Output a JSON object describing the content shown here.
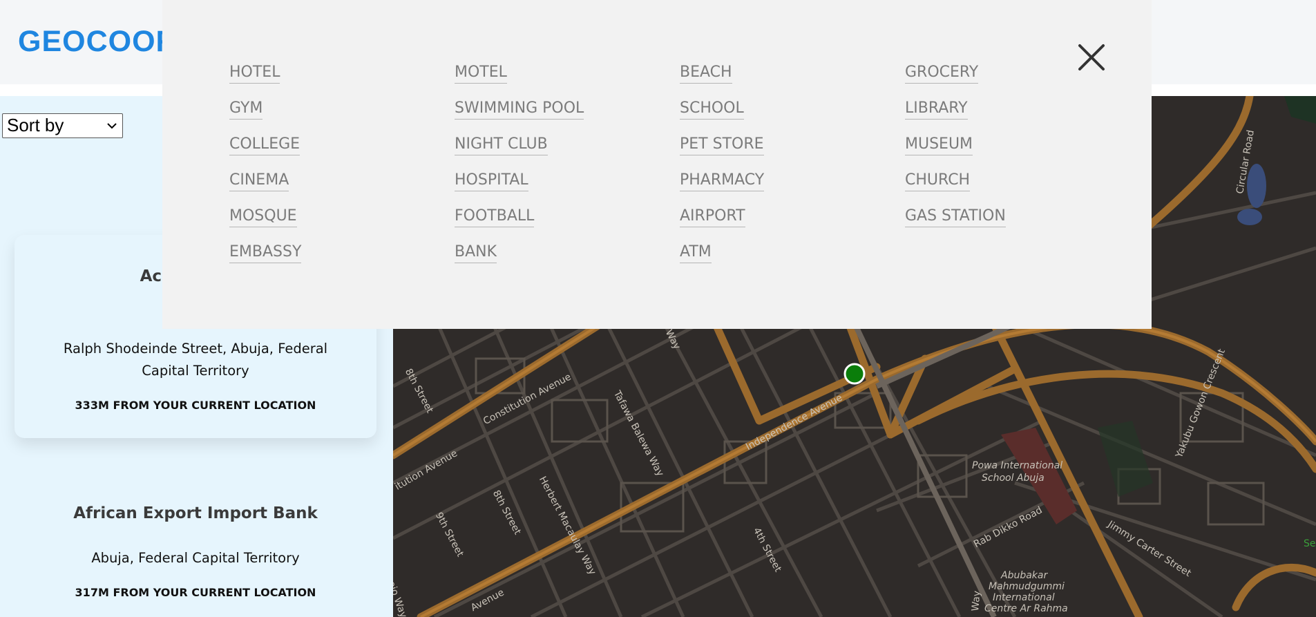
{
  "header": {
    "logo_text": "GEOCOOR"
  },
  "sidebar": {
    "sort": {
      "selected": "Sort by"
    },
    "cards": [
      {
        "title": "Access Bank",
        "address": "Ralph Shodeinde Street, Abuja, Federal Capital Territory",
        "distance": "333M FROM YOUR CURRENT LOCATION"
      },
      {
        "title": "African Export Import Bank",
        "address": "Abuja, Federal Capital Territory",
        "distance": "317M FROM YOUR CURRENT LOCATION"
      }
    ]
  },
  "overlay": {
    "close_icon": "close-icon",
    "categories": [
      [
        "HOTEL",
        "MOTEL",
        "BEACH",
        "GROCERY"
      ],
      [
        "GYM",
        "SWIMMING POOL",
        "SCHOOL",
        "LIBRARY"
      ],
      [
        "COLLEGE",
        "NIGHT CLUB",
        "PET STORE",
        "MUSEUM"
      ],
      [
        "CINEMA",
        "HOSPITAL",
        "PHARMACY",
        "CHURCH"
      ],
      [
        "MOSQUE",
        "FOOTBALL",
        "AIRPORT",
        "GAS STATION"
      ],
      [
        "EMBASSY",
        "BANK",
        "ATM"
      ]
    ]
  },
  "map": {
    "marker_color": "#0a7d0a",
    "labels": {
      "constitution_1": "Constitution Avenue",
      "constitution_2": "itution Avenue",
      "eighth_1": "8th Street",
      "eighth_2": "8th Street",
      "ninth": "9th Street",
      "sani_abacha": "Sani Abacha Way",
      "tafawa": "Tafawa Balewa Way",
      "herbert": "Herbert Macaulay Way",
      "independence": "Independence Avenue",
      "fourth": "4th Street",
      "powa": "Powa International",
      "powa_2": "School Abuja",
      "rab_dikko": "Rab Dikko Road",
      "yakubu": "Yakubu Gowon Crescent",
      "jimmy": "Jimmy Carter Street",
      "circular": "Circular Road",
      "abubakar_1": "Abubakar",
      "abubakar_2": "Mahmudgummi",
      "abubakar_3": "International",
      "abubakar_4": "Centre Ar Rahma",
      "way": "Way",
      "avenue_bottom": "Avenue",
      "ojo": "ojo Way",
      "se": "Se"
    }
  }
}
